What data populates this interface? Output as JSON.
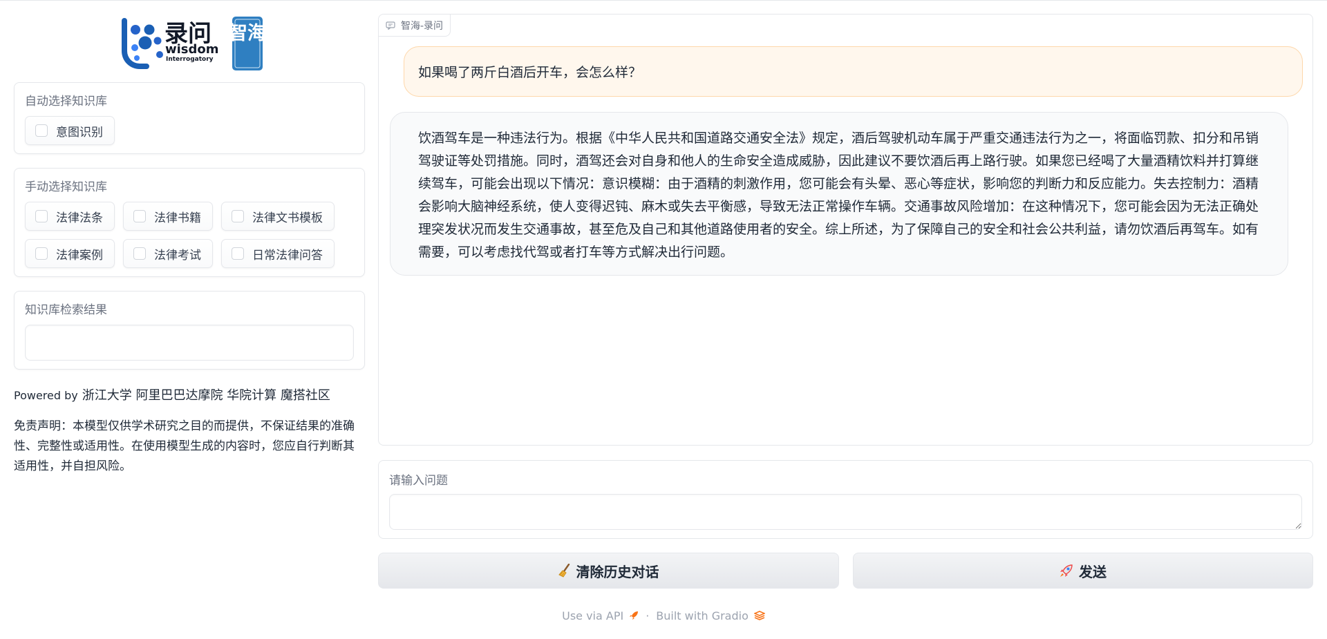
{
  "logo": {
    "cn": "录问",
    "en_word": "wisdom",
    "en_sub": "Interrogatory",
    "seal": "智海"
  },
  "auto_kb": {
    "label": "自动选择知识库",
    "options": [
      {
        "label": "意图识别"
      }
    ]
  },
  "manual_kb": {
    "label": "手动选择知识库",
    "options": [
      {
        "label": "法律法条"
      },
      {
        "label": "法律书籍"
      },
      {
        "label": "法律文书模板"
      },
      {
        "label": "法律案例"
      },
      {
        "label": "法律考试"
      },
      {
        "label": "日常法律问答"
      }
    ]
  },
  "kb_result": {
    "label": "知识库检索结果",
    "value": ""
  },
  "powered": {
    "prefix": "Powered by",
    "orgs": "浙江大学 阿里巴巴达摩院 华院计算 魔搭社区"
  },
  "disclaimer": "免责声明：本模型仅供学术研究之目的而提供，不保证结果的准确性、完整性或适用性。在使用模型生成的内容时，您应自行判断其适用性，并自担风险。",
  "chat": {
    "tag": "智海-录问",
    "user_message": "如果喝了两斤白酒后开车，会怎么样？",
    "bot_message": "饮酒驾车是一种违法行为。根据《中华人民共和国道路交通安全法》规定，酒后驾驶机动车属于严重交通违法行为之一，将面临罚款、扣分和吊销驾驶证等处罚措施。同时，酒驾还会对自身和他人的生命安全造成威胁，因此建议不要饮酒后再上路行驶。如果您已经喝了大量酒精饮料并打算继续驾车，可能会出现以下情况：意识模糊：由于酒精的刺激作用，您可能会有头晕、恶心等症状，影响您的判断力和反应能力。失去控制力：酒精会影响大脑神经系统，使人变得迟钝、麻木或失去平衡感，导致无法正常操作车辆。交通事故风险增加：在这种情况下，您可能会因为无法正确处理突发状况而发生交通事故，甚至危及自己和其他道路使用者的安全。综上所述，为了保障自己的安全和社会公共利益，请勿饮酒后再驾车。如有需要，可以考虑找代驾或者打车等方式解决出行问题。"
  },
  "question": {
    "label": "请输入问题",
    "value": ""
  },
  "buttons": {
    "clear": "清除历史对话",
    "send": "发送"
  },
  "footer": {
    "api": "Use via API",
    "sep": "·",
    "gradio": "Built with Gradio"
  },
  "colors": {
    "user_bubble_bg": "#fff7ed",
    "user_bubble_border": "#fed7aa",
    "bot_bubble_bg": "#f9fafb",
    "logo_blue": "#1a5fb4",
    "gradio_orange": "#f97316"
  }
}
